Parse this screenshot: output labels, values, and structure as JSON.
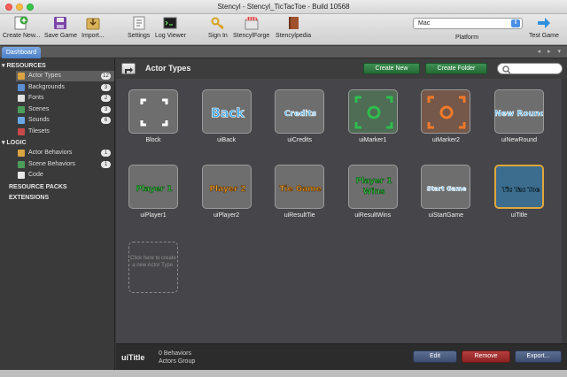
{
  "window": {
    "title": "Stencyl - Stencyl_TicTacToe - Build 10568"
  },
  "toolbar": {
    "create_new": "Create New...",
    "save_game": "Save Game",
    "import": "Import...",
    "settings": "Settings",
    "log_viewer": "Log Viewer",
    "sign_in": "Sign In",
    "stencylforge": "StencylForge",
    "stencylpedia": "Stencylpedia",
    "platform_value": "Mac",
    "platform_label": "Platform",
    "test_game": "Test Game"
  },
  "tabs": {
    "dashboard": "Dashboard",
    "arrows": "◂ ▸ ▾"
  },
  "sidebar": {
    "resources_head": "RESOURCES",
    "resources": [
      {
        "label": "Actor Types",
        "count": "12",
        "color": "#d9a441"
      },
      {
        "label": "Backgrounds",
        "count": "3",
        "color": "#5a8fd4"
      },
      {
        "label": "Fonts",
        "count": "2",
        "color": "#e0e0e0"
      },
      {
        "label": "Scenes",
        "count": "3",
        "color": "#4c9e5a"
      },
      {
        "label": "Sounds",
        "count": "6",
        "color": "#6aa8e8"
      },
      {
        "label": "Tilesets",
        "count": "",
        "color": "#c94a4a"
      }
    ],
    "logic_head": "LOGIC",
    "logic": [
      {
        "label": "Actor Behaviors",
        "count": "1",
        "color": "#d9a441"
      },
      {
        "label": "Scene Behaviors",
        "count": "1",
        "color": "#4c9e5a"
      },
      {
        "label": "Code",
        "count": "",
        "color": "#e8e8e8"
      }
    ],
    "resource_packs": "RESOURCE PACKS",
    "extensions": "EXTENSIONS"
  },
  "main": {
    "title": "Actor Types",
    "create_new_label": "Create New",
    "create_folder_label": "Create Folder",
    "new_tile_text": "Click here to create a new Actor Type.",
    "actors": [
      {
        "label": "Block",
        "art": "Block"
      },
      {
        "label": "uiBack",
        "art": "Back"
      },
      {
        "label": "uiCredits",
        "art": "Credits"
      },
      {
        "label": "uiMarker1",
        "art": ""
      },
      {
        "label": "uiMarker2",
        "art": ""
      },
      {
        "label": "uiNewRound",
        "art": "New Round"
      },
      {
        "label": "uiPlayer1",
        "art": "Player 1"
      },
      {
        "label": "uiPlayer2",
        "art": "Player 2"
      },
      {
        "label": "uiResultTie",
        "art": "Tie Game"
      },
      {
        "label": "uiResultWins",
        "art": "Player 1 Wins"
      },
      {
        "label": "uiStartGame",
        "art": "Start Game"
      },
      {
        "label": "uiTitle",
        "art": "Tic Tac Toe"
      }
    ]
  },
  "bottom": {
    "selected_name": "uiTitle",
    "behaviors": "0 Behaviors",
    "group": "Actors Group",
    "edit": "Edit",
    "remove": "Remove",
    "export": "Export..."
  }
}
